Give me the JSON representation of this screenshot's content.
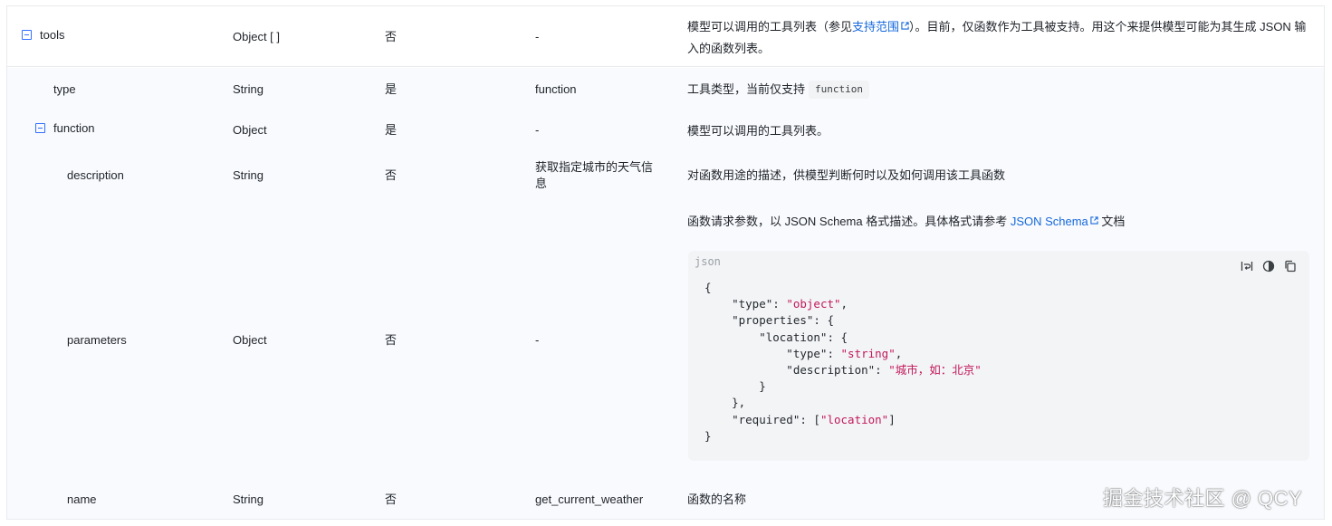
{
  "rows": {
    "tools": {
      "name": "tools",
      "type": "Object [ ]",
      "required": "否",
      "default": "-",
      "desc_prefix": "模型可以调用的工具列表（参见",
      "desc_link": "支持范围",
      "desc_suffix": "）。目前，仅函数作为工具被支持。用这个来提供模型可能为其生成 JSON 输",
      "desc_line2": "入的函数列表。"
    },
    "type_row": {
      "name": "type",
      "type": "String",
      "required": "是",
      "default": "function",
      "desc": "工具类型，当前仅支持",
      "code": "function"
    },
    "function_row": {
      "name": "function",
      "type": "Object",
      "required": "是",
      "default": "-",
      "desc": "模型可以调用的工具列表。"
    },
    "description_row": {
      "name": "description",
      "type": "String",
      "required": "否",
      "default_line1": "获取指定城市的天气信",
      "default_line2": "息",
      "desc": "对函数用途的描述，供模型判断何时以及如何调用该工具函数"
    },
    "parameters_row": {
      "name": "parameters",
      "type": "Object",
      "required": "否",
      "default": "-",
      "desc_prefix": "函数请求参数，以 JSON Schema 格式描述。具体格式请参考 ",
      "desc_link": "JSON Schema",
      "desc_suffix": " 文档",
      "code_lang": "json",
      "code": {
        "l1": "{",
        "l2_key": "    \"type\": ",
        "l2_val": "\"object\"",
        "l2_end": ",",
        "l3": "    \"properties\": {",
        "l4": "        \"location\": {",
        "l5_key": "            \"type\": ",
        "l5_val": "\"string\"",
        "l5_end": ",",
        "l6_key": "            \"description\": ",
        "l6_val": "\"城市，如：北京\"",
        "l7": "        }",
        "l8": "    },",
        "l9_key": "    \"required\": [",
        "l9_val": "\"location\"",
        "l9_end": "]",
        "l10": "}"
      }
    },
    "name_row": {
      "name": "name",
      "type": "String",
      "required": "否",
      "default": "get_current_weather",
      "desc": "函数的名称"
    }
  },
  "icons": {
    "expand": "minus-square-icon",
    "external": "external-link-icon",
    "wrap": "wrap-lines-icon",
    "theme": "theme-contrast-icon",
    "copy": "copy-icon"
  },
  "colors": {
    "link": "#1668dc",
    "expand_border": "#3370ff",
    "string_literal": "#c2185b",
    "nested_background": "#f8fafd"
  },
  "watermark": "掘金技术社区 @ QCY"
}
